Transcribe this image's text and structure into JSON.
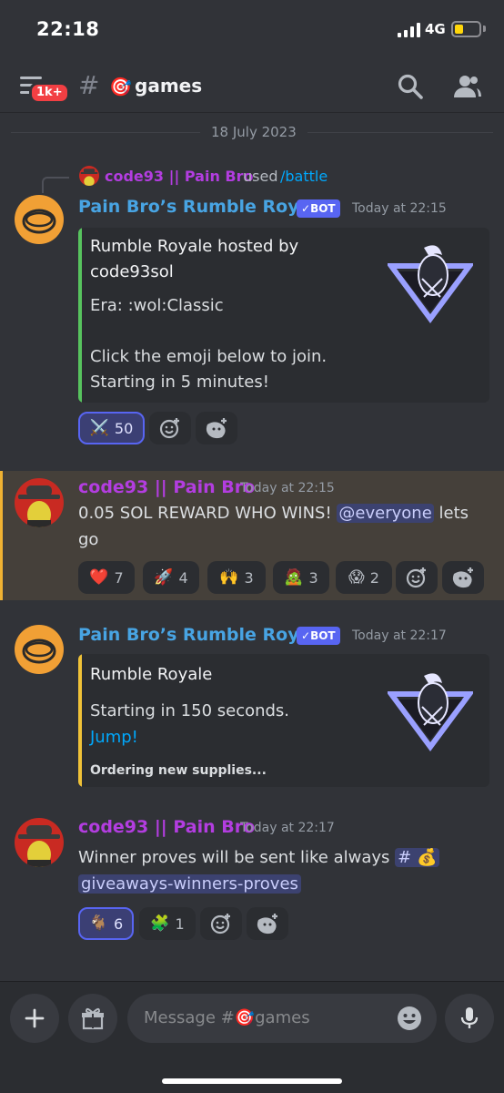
{
  "status_bar": {
    "time": "22:18",
    "network": "4G",
    "battery_percent": 25
  },
  "header": {
    "badge": "1k+",
    "channel_emoji": "🎯",
    "channel_name": "games"
  },
  "date_divider": "18 July 2023",
  "messages": [
    {
      "reply": {
        "name": "code93 || Pain Bro",
        "used": "used",
        "command": "/battle"
      },
      "author": "Pain Bro’s Rumble Royale",
      "bot_tag": "BOT",
      "timestamp": "Today at 22:15",
      "embed": {
        "title_line1": "Rumble Royale hosted by",
        "title_line2": "code93sol",
        "era": "Era: :wol:Classic",
        "line1": "Click the emoji below to join.",
        "line2": "Starting in 5 minutes!",
        "accent": "#57c35e"
      },
      "reactions": [
        {
          "emoji": "⚔️",
          "count": "50",
          "me": true
        }
      ]
    },
    {
      "author": "code93 || Pain Bro",
      "timestamp": "Today at 22:15",
      "text_before": "0.05 SOL REWARD WHO WINS!",
      "mention": "@everyone",
      "text_after": "lets",
      "text_line2": "go",
      "reactions": [
        {
          "emoji": "❤️",
          "count": "7"
        },
        {
          "emoji": "🚀",
          "count": "4"
        },
        {
          "emoji": "🙌",
          "count": "3"
        },
        {
          "emoji": "🧟",
          "count": "3"
        },
        {
          "emoji": "😱",
          "count": "2"
        }
      ]
    },
    {
      "author": "Pain Bro’s Rumble Royale",
      "bot_tag": "BOT",
      "timestamp": "Today at 22:17",
      "embed": {
        "title": "Rumble Royale",
        "line1": "Starting in 150 seconds.",
        "link": "Jump!",
        "footer": "Ordering new supplies...",
        "accent": "#f0c238"
      }
    },
    {
      "author": "code93 || Pain Bro",
      "timestamp": "Today at 22:17",
      "text": "Winner proves will be sent like always",
      "channel_hash": "#",
      "channel_emoji": "💰",
      "channel_name": "giveaways-winners-proves",
      "reactions": [
        {
          "emoji": "🐐",
          "count": "6",
          "me": true
        },
        {
          "emoji": "🧩",
          "count": "1"
        }
      ]
    }
  ],
  "composer": {
    "placeholder_prefix": "Message #",
    "placeholder_emoji": "🎯",
    "placeholder_channel": "games"
  }
}
